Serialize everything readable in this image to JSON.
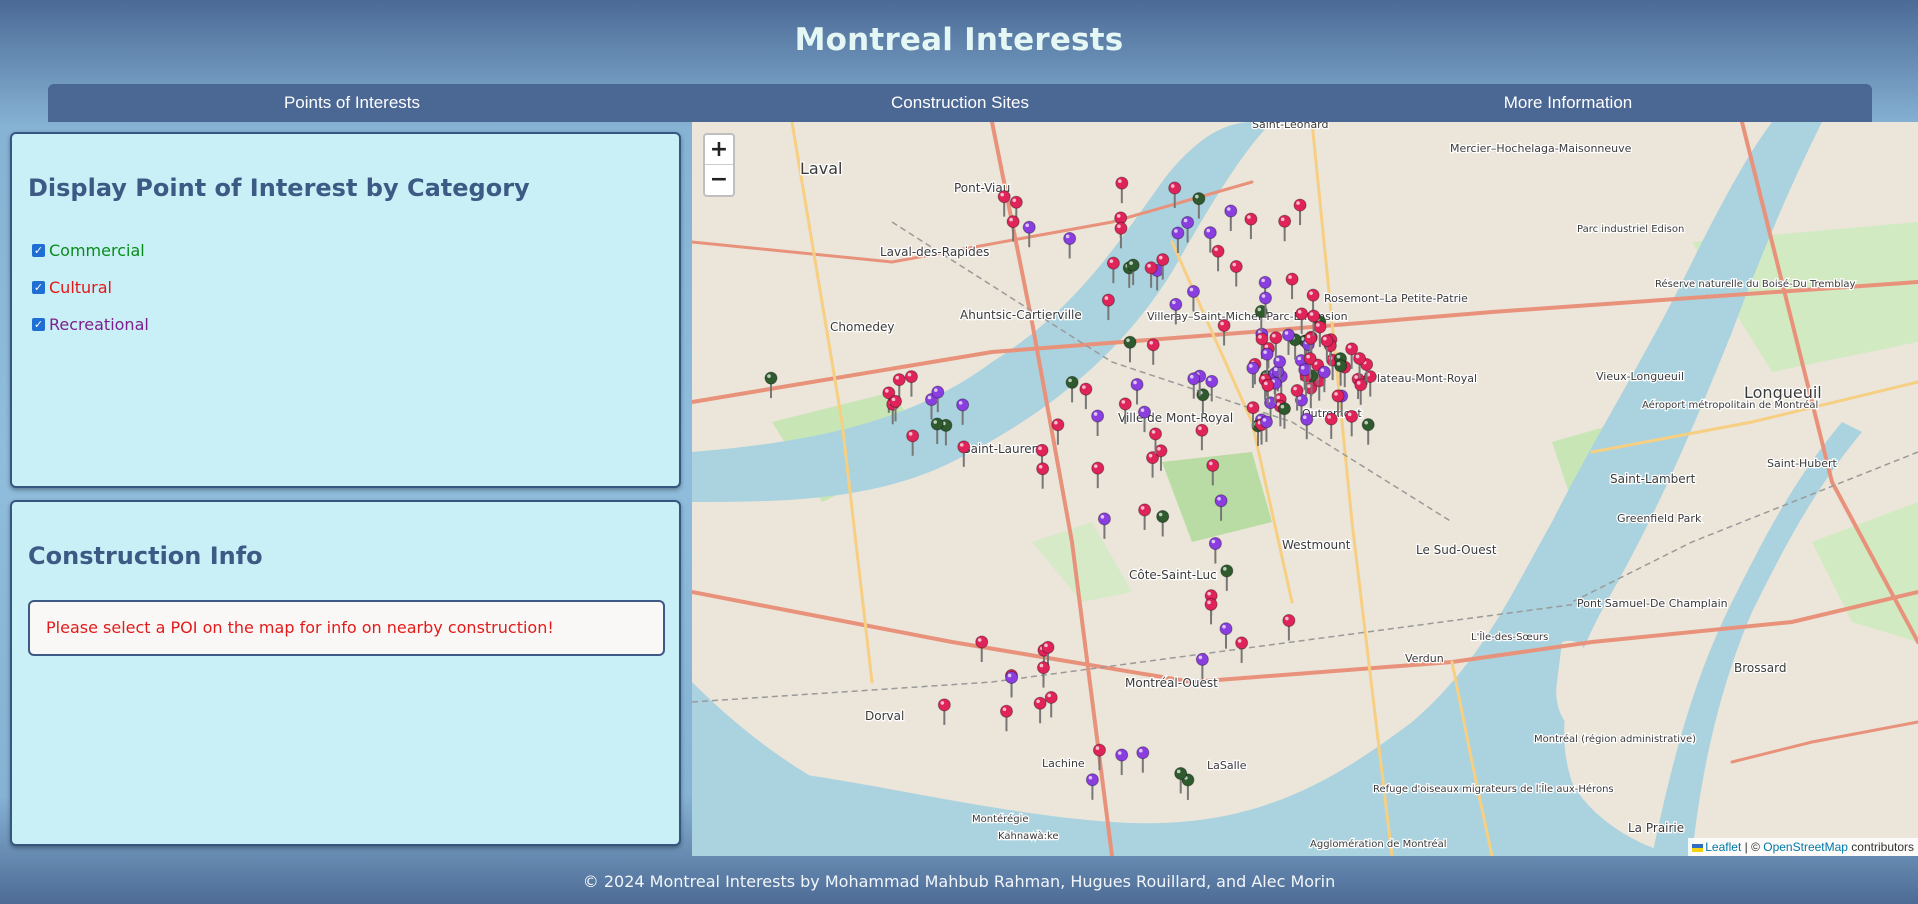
{
  "header": {
    "title": "Montreal Interests"
  },
  "nav": {
    "tabs": [
      {
        "label": "Points of Interests"
      },
      {
        "label": "Construction Sites"
      },
      {
        "label": "More Information"
      }
    ]
  },
  "poi_panel": {
    "title": "Display Point of Interest by Category",
    "categories": [
      {
        "label": "Commercial",
        "checked": true,
        "color": "#0b8a1c"
      },
      {
        "label": "Cultural",
        "checked": true,
        "color": "#e51616"
      },
      {
        "label": "Recreational",
        "checked": true,
        "color": "#7d1f8c"
      }
    ]
  },
  "construction_panel": {
    "title": "Construction Info",
    "message": "Please select a POI on the map for info on nearby construction!"
  },
  "map": {
    "zoom_in": "+",
    "zoom_out": "−",
    "attribution": {
      "leaflet": "Leaflet",
      "separator": " | © ",
      "osm": "OpenStreetMap",
      "suffix": " contributors"
    },
    "place_labels": [
      "Laval",
      "Pont-Viau",
      "Laval-des-Rapides",
      "Chomedey",
      "Ahuntsic-Cartierville",
      "Villeray–Saint-Michel–Parc-Extension",
      "Rosemont–La Petite-Patrie",
      "Mercier–Hochelaga-Maisonneuve",
      "Saint-Léonard",
      "Le Plateau-Mont-Royal",
      "Outremont",
      "Ville de Mont-Royal",
      "Saint-Laurent",
      "Côte-Saint-Luc",
      "Westmount",
      "Le Sud-Ouest",
      "Verdun",
      "Montréal-Ouest",
      "LaSalle",
      "Lachine",
      "Dorval",
      "Longueuil",
      "Vieux-Longueuil",
      "Saint-Lambert",
      "Greenfield Park",
      "Saint-Hubert",
      "Brossard",
      "L'Île-des-Sœurs",
      "Pont Samuel-De Champlain",
      "Parc industriel Edison",
      "Réserve naturelle du Boisé-Du Tremblay",
      "Aéroport métropolitain de Montréal",
      "Refuge d'oiseaux migrateurs de l'Île aux-Hérons",
      "Kahnawà:ke",
      "La Prairie",
      "Montérégie",
      "Montréal (région administrative)",
      "Agglomération de Montréal"
    ],
    "marker_colors": {
      "commercial": "#2e5a2e",
      "cultural": "#e0245a",
      "recreational": "#8a3ee0"
    }
  },
  "footer": {
    "text": "© 2024 Montreal Interests by Mohammad Mahbub Rahman, Hugues Rouillard, and Alec Morin"
  }
}
